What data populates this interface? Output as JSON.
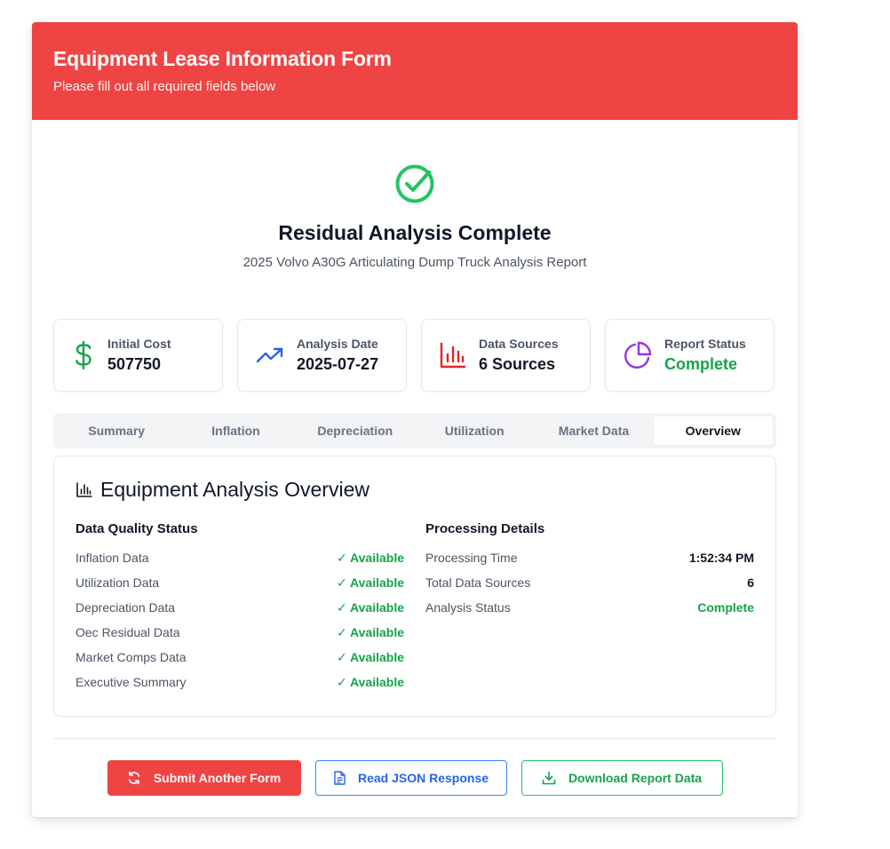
{
  "header": {
    "title": "Equipment Lease Information Form",
    "subtitle": "Please fill out all required fields below"
  },
  "hero": {
    "title": "Residual Analysis Complete",
    "subtitle": "2025 Volvo A30G Articulating Dump Truck Analysis Report"
  },
  "stats": [
    {
      "label": "Initial Cost",
      "value": "507750",
      "icon": "dollar-icon",
      "color": "#16a34a"
    },
    {
      "label": "Analysis Date",
      "value": "2025-07-27",
      "icon": "trending-up-icon",
      "color": "#2563eb"
    },
    {
      "label": "Data Sources",
      "value": "6 Sources",
      "icon": "bar-chart-icon",
      "color": "#dc2626"
    },
    {
      "label": "Report Status",
      "value": "Complete",
      "icon": "pie-chart-icon",
      "color": "#9333ea"
    }
  ],
  "tabs": [
    "Summary",
    "Inflation",
    "Depreciation",
    "Utilization",
    "Market Data",
    "Overview"
  ],
  "active_tab": "Overview",
  "panel": {
    "title": "Equipment Analysis Overview",
    "quality": {
      "title": "Data Quality Status",
      "rows": [
        {
          "label": "Inflation Data",
          "value": "✓ Available"
        },
        {
          "label": "Utilization Data",
          "value": "✓ Available"
        },
        {
          "label": "Depreciation Data",
          "value": "✓ Available"
        },
        {
          "label": "Oec Residual Data",
          "value": "✓ Available"
        },
        {
          "label": "Market Comps Data",
          "value": "✓ Available"
        },
        {
          "label": "Executive Summary",
          "value": "✓ Available"
        }
      ]
    },
    "processing": {
      "title": "Processing Details",
      "rows": [
        {
          "label": "Processing Time",
          "value": "1:52:34 PM"
        },
        {
          "label": "Total Data Sources",
          "value": "6"
        },
        {
          "label": "Analysis Status",
          "value": "Complete"
        }
      ]
    }
  },
  "actions": {
    "submit_another": "Submit Another Form",
    "read_json": "Read JSON Response",
    "download": "Download Report Data"
  },
  "colors": {
    "brand_red": "#ef4444",
    "success_green": "#16a34a",
    "info_blue": "#2563eb"
  }
}
